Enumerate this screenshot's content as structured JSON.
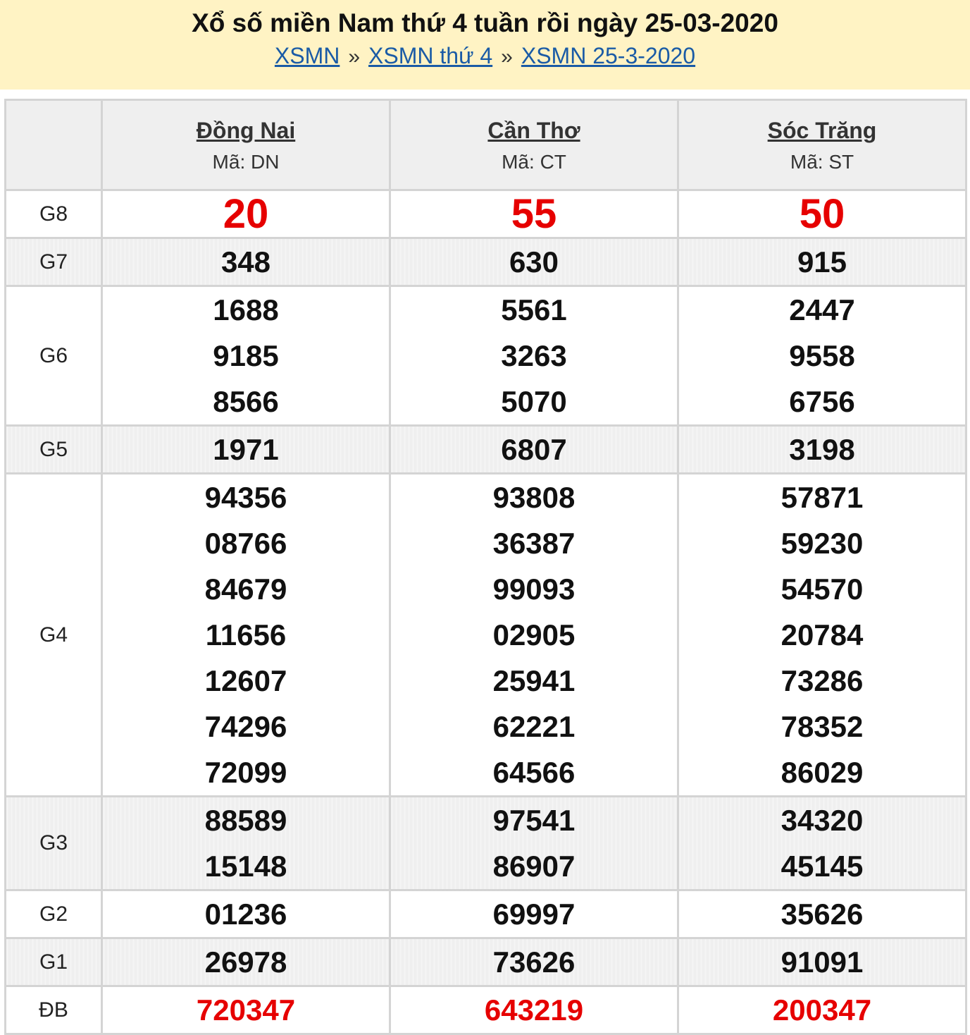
{
  "header": {
    "title": "Xổ số miền Nam thứ 4 tuần rồi ngày 25-03-2020",
    "breadcrumb": [
      {
        "label": "XSMN"
      },
      {
        "label": "XSMN thứ 4"
      },
      {
        "label": "XSMN 25-3-2020"
      }
    ],
    "separator": "»"
  },
  "provinces": [
    {
      "name": "Đồng Nai",
      "code": "Mã: DN"
    },
    {
      "name": "Cần Thơ",
      "code": "Mã: CT"
    },
    {
      "name": "Sóc Trăng",
      "code": "Mã: ST"
    }
  ],
  "prizes": {
    "g8": {
      "label": "G8",
      "values": [
        [
          "20"
        ],
        [
          "55"
        ],
        [
          "50"
        ]
      ]
    },
    "g7": {
      "label": "G7",
      "values": [
        [
          "348"
        ],
        [
          "630"
        ],
        [
          "915"
        ]
      ]
    },
    "g6": {
      "label": "G6",
      "values": [
        [
          "1688",
          "9185",
          "8566"
        ],
        [
          "5561",
          "3263",
          "5070"
        ],
        [
          "2447",
          "9558",
          "6756"
        ]
      ]
    },
    "g5": {
      "label": "G5",
      "values": [
        [
          "1971"
        ],
        [
          "6807"
        ],
        [
          "3198"
        ]
      ]
    },
    "g4": {
      "label": "G4",
      "values": [
        [
          "94356",
          "08766",
          "84679",
          "11656",
          "12607",
          "74296",
          "72099"
        ],
        [
          "93808",
          "36387",
          "99093",
          "02905",
          "25941",
          "62221",
          "64566"
        ],
        [
          "57871",
          "59230",
          "54570",
          "20784",
          "73286",
          "78352",
          "86029"
        ]
      ]
    },
    "g3": {
      "label": "G3",
      "values": [
        [
          "88589",
          "15148"
        ],
        [
          "97541",
          "86907"
        ],
        [
          "34320",
          "45145"
        ]
      ]
    },
    "g2": {
      "label": "G2",
      "values": [
        [
          "01236"
        ],
        [
          "69997"
        ],
        [
          "35626"
        ]
      ]
    },
    "g1": {
      "label": "G1",
      "values": [
        [
          "26978"
        ],
        [
          "73626"
        ],
        [
          "91091"
        ]
      ]
    },
    "db": {
      "label": "ĐB",
      "values": [
        [
          "720347"
        ],
        [
          "643219"
        ],
        [
          "200347"
        ]
      ]
    }
  },
  "colors": {
    "header_bg": "#fff3c4",
    "link": "#1a5ba6",
    "highlight_red": "#e60000",
    "row_alt_bg": "#efefef",
    "border": "#d4d4d4"
  }
}
